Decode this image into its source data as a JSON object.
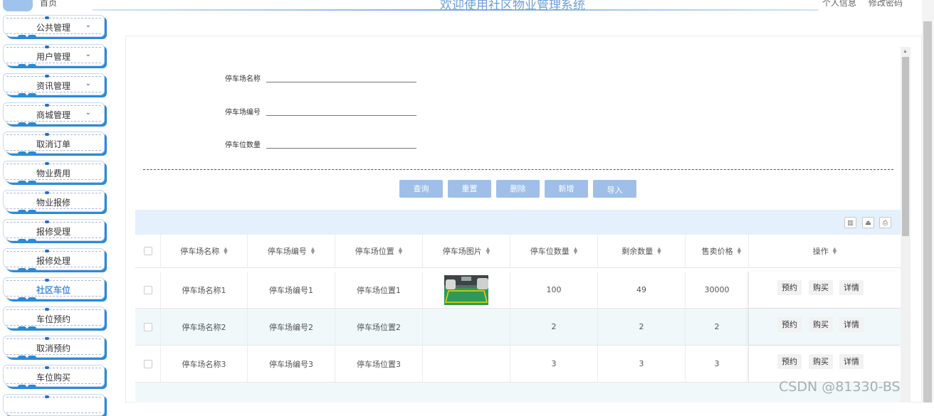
{
  "header": {
    "brand": "首页",
    "title": "欢迎使用社区物业管理系统",
    "right_links": [
      "个人信息",
      "修改密码"
    ]
  },
  "sidebar": {
    "items": [
      {
        "label": "公共管理",
        "has_chevron": true
      },
      {
        "label": "用户管理",
        "has_chevron": true
      },
      {
        "label": "资讯管理",
        "has_chevron": true
      },
      {
        "label": "商城管理",
        "has_chevron": true
      },
      {
        "label": "取消订单",
        "has_chevron": false
      },
      {
        "label": "物业费用",
        "has_chevron": false
      },
      {
        "label": "物业报修",
        "has_chevron": false
      },
      {
        "label": "报修受理",
        "has_chevron": false
      },
      {
        "label": "报修处理",
        "has_chevron": false
      },
      {
        "label": "社区车位",
        "has_chevron": false,
        "active": true
      },
      {
        "label": "车位预约",
        "has_chevron": false
      },
      {
        "label": "取消预约",
        "has_chevron": false
      },
      {
        "label": "车位购买",
        "has_chevron": false
      }
    ],
    "chevron": "⌄",
    "accent_color": "#2a8bd8"
  },
  "search": {
    "fields": [
      {
        "label": "停车场名称",
        "value": ""
      },
      {
        "label": "停车场编号",
        "value": ""
      },
      {
        "label": "停车位数量",
        "value": ""
      }
    ],
    "buttons": [
      "查询",
      "重置",
      "删除",
      "新增",
      "导入"
    ]
  },
  "table": {
    "toolbar_icons": [
      "columns-icon",
      "export-icon",
      "print-icon"
    ],
    "columns": [
      "停车场名称",
      "停车场编号",
      "停车场位置",
      "停车场图片",
      "停车位数量",
      "剩余数量",
      "售卖价格",
      "操作"
    ],
    "rows": [
      {
        "name": "停车场名称1",
        "code": "停车场编号1",
        "location": "停车场位置1",
        "has_image": true,
        "total": "100",
        "remaining": "49",
        "price": "30000"
      },
      {
        "name": "停车场名称2",
        "code": "停车场编号2",
        "location": "停车场位置2",
        "has_image": false,
        "total": "2",
        "remaining": "2",
        "price": "2"
      },
      {
        "name": "停车场名称3",
        "code": "停车场编号3",
        "location": "停车场位置3",
        "has_image": false,
        "total": "3",
        "remaining": "3",
        "price": "3"
      }
    ],
    "row_actions": [
      "预约",
      "购买",
      "详情"
    ]
  },
  "watermark": "CSDN @81330-BS",
  "colors": {
    "button": "#9fbfe8",
    "toolbar_bg": "#e4f0fb",
    "row_alt": "#f0f8fa",
    "title": "#6b9ed8"
  }
}
